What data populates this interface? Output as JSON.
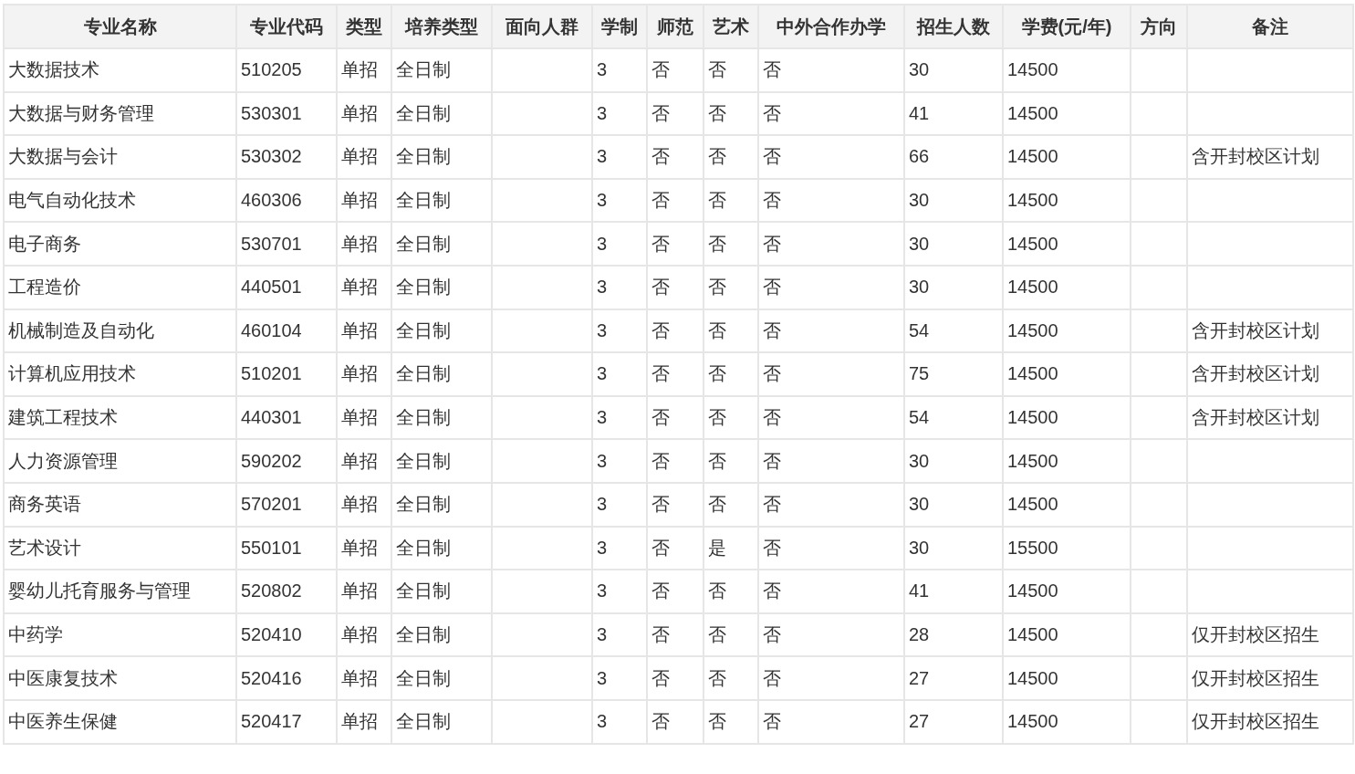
{
  "table": {
    "columns": [
      "专业名称",
      "专业代码",
      "类型",
      "培养类型",
      "面向人群",
      "学制",
      "师范",
      "艺术",
      "中外合作办学",
      "招生人数",
      "学费(元/年)",
      "方向",
      "备注"
    ],
    "rows": [
      [
        "大数据技术",
        "510205",
        "单招",
        "全日制",
        "",
        "3",
        "否",
        "否",
        "否",
        "30",
        "14500",
        "",
        ""
      ],
      [
        "大数据与财务管理",
        "530301",
        "单招",
        "全日制",
        "",
        "3",
        "否",
        "否",
        "否",
        "41",
        "14500",
        "",
        ""
      ],
      [
        "大数据与会计",
        "530302",
        "单招",
        "全日制",
        "",
        "3",
        "否",
        "否",
        "否",
        "66",
        "14500",
        "",
        "含开封校区计划"
      ],
      [
        "电气自动化技术",
        "460306",
        "单招",
        "全日制",
        "",
        "3",
        "否",
        "否",
        "否",
        "30",
        "14500",
        "",
        ""
      ],
      [
        "电子商务",
        "530701",
        "单招",
        "全日制",
        "",
        "3",
        "否",
        "否",
        "否",
        "30",
        "14500",
        "",
        ""
      ],
      [
        "工程造价",
        "440501",
        "单招",
        "全日制",
        "",
        "3",
        "否",
        "否",
        "否",
        "30",
        "14500",
        "",
        ""
      ],
      [
        "机械制造及自动化",
        "460104",
        "单招",
        "全日制",
        "",
        "3",
        "否",
        "否",
        "否",
        "54",
        "14500",
        "",
        "含开封校区计划"
      ],
      [
        "计算机应用技术",
        "510201",
        "单招",
        "全日制",
        "",
        "3",
        "否",
        "否",
        "否",
        "75",
        "14500",
        "",
        "含开封校区计划"
      ],
      [
        "建筑工程技术",
        "440301",
        "单招",
        "全日制",
        "",
        "3",
        "否",
        "否",
        "否",
        "54",
        "14500",
        "",
        "含开封校区计划"
      ],
      [
        "人力资源管理",
        "590202",
        "单招",
        "全日制",
        "",
        "3",
        "否",
        "否",
        "否",
        "30",
        "14500",
        "",
        ""
      ],
      [
        "商务英语",
        "570201",
        "单招",
        "全日制",
        "",
        "3",
        "否",
        "否",
        "否",
        "30",
        "14500",
        "",
        ""
      ],
      [
        "艺术设计",
        "550101",
        "单招",
        "全日制",
        "",
        "3",
        "否",
        "是",
        "否",
        "30",
        "15500",
        "",
        ""
      ],
      [
        "婴幼儿托育服务与管理",
        "520802",
        "单招",
        "全日制",
        "",
        "3",
        "否",
        "否",
        "否",
        "41",
        "14500",
        "",
        ""
      ],
      [
        "中药学",
        "520410",
        "单招",
        "全日制",
        "",
        "3",
        "否",
        "否",
        "否",
        "28",
        "14500",
        "",
        "仅开封校区招生"
      ],
      [
        "中医康复技术",
        "520416",
        "单招",
        "全日制",
        "",
        "3",
        "否",
        "否",
        "否",
        "27",
        "14500",
        "",
        "仅开封校区招生"
      ],
      [
        "中医养生保健",
        "520417",
        "单招",
        "全日制",
        "",
        "3",
        "否",
        "否",
        "否",
        "27",
        "14500",
        "",
        "仅开封校区招生"
      ]
    ]
  }
}
